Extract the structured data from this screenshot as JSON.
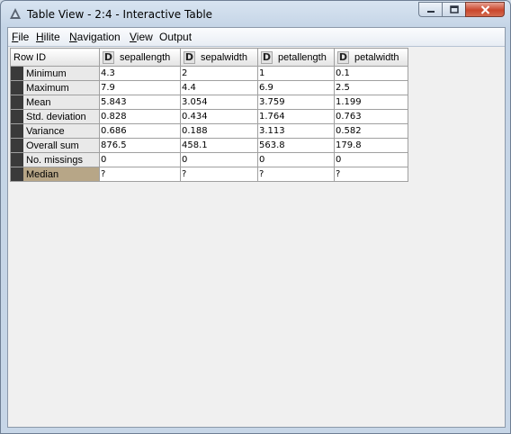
{
  "window": {
    "title": "Table View - 2:4 - Interactive Table"
  },
  "menu": [
    {
      "accel": "F",
      "rest": "ile"
    },
    {
      "accel": "H",
      "rest": "ilite"
    },
    {
      "accel": "N",
      "rest": "avigation"
    },
    {
      "accel": "V",
      "rest": "iew"
    },
    {
      "accel": "",
      "rest": "Output"
    }
  ],
  "table": {
    "row_id_header": "Row ID",
    "column_type_badge": "D",
    "columns": [
      "sepallength",
      "sepalwidth",
      "petallength",
      "petalwidth"
    ],
    "rows": [
      {
        "label": "Minimum",
        "values": [
          "4.3",
          "2",
          "1",
          "0.1"
        ]
      },
      {
        "label": "Maximum",
        "values": [
          "7.9",
          "4.4",
          "6.9",
          "2.5"
        ]
      },
      {
        "label": "Mean",
        "values": [
          "5.843",
          "3.054",
          "3.759",
          "1.199"
        ]
      },
      {
        "label": "Std. deviation",
        "values": [
          "0.828",
          "0.434",
          "1.764",
          "0.763"
        ]
      },
      {
        "label": "Variance",
        "values": [
          "0.686",
          "0.188",
          "3.113",
          "0.582"
        ]
      },
      {
        "label": "Overall sum",
        "values": [
          "876.5",
          "458.1",
          "563.8",
          "179.8"
        ]
      },
      {
        "label": "No. missings",
        "values": [
          "0",
          "0",
          "0",
          "0"
        ]
      },
      {
        "label": "Median",
        "values": [
          "?",
          "?",
          "?",
          "?"
        ]
      }
    ],
    "selected_row_label": "Median",
    "selected_row_color": "#b7a687"
  }
}
